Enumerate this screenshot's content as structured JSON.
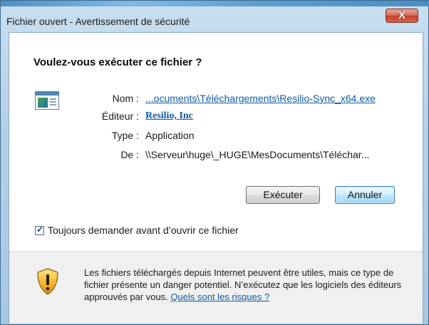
{
  "window": {
    "title": "Fichier ouvert - Avertissement de sécurité",
    "close_label": "X"
  },
  "dialog": {
    "heading": "Voulez-vous exécuter ce fichier ?",
    "fields": {
      "name_label": "Nom :",
      "name_value": "...ocuments\\Téléchargements\\Resilio-Sync_x64.exe",
      "publisher_label": "Éditeur :",
      "publisher_value": "Resilio, Inc",
      "type_label": "Type :",
      "type_value": "Application",
      "from_label": "De :",
      "from_value": "\\\\Serveur\\huge\\_HUGE\\MesDocuments\\Téléchar..."
    },
    "buttons": {
      "run": "Exécuter",
      "cancel": "Annuler"
    },
    "always_ask": {
      "checked": true,
      "label": "Toujours demander avant d’ouvrir ce fichier"
    },
    "warning": {
      "text": "Les fichiers téléchargés depuis Internet peuvent être utiles, mais ce type de fichier présente un danger potentiel. N’exécutez que les logiciels des éditeurs approuvés par vous.",
      "link": "Quels sont les risques ?"
    }
  },
  "colors": {
    "link": "#0b5ba8",
    "close_button": "#c4402a",
    "frame": "#b4d0e8"
  },
  "icons": [
    "file-icon",
    "close-icon",
    "checkmark-icon",
    "shield-warning-icon"
  ]
}
